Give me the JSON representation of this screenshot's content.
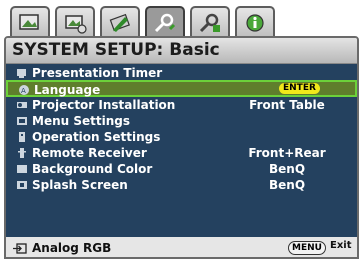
{
  "tabs": [
    {
      "icon": "picture-icon"
    },
    {
      "icon": "advanced-picture-icon"
    },
    {
      "icon": "display-icon"
    },
    {
      "icon": "system-setup-basic-icon",
      "active": true
    },
    {
      "icon": "system-setup-advanced-icon"
    },
    {
      "icon": "information-icon"
    }
  ],
  "title": "SYSTEM SETUP: Basic",
  "menu": {
    "items": [
      {
        "label": "Presentation Timer",
        "value": "",
        "icon": "timer-icon"
      },
      {
        "label": "Language",
        "value": "ENTER",
        "icon": "language-icon",
        "selected": true
      },
      {
        "label": "Projector Installation",
        "value": "Front Table",
        "icon": "projector-icon"
      },
      {
        "label": "Menu Settings",
        "value": "",
        "icon": "menu-settings-icon"
      },
      {
        "label": "Operation Settings",
        "value": "",
        "icon": "operation-settings-icon"
      },
      {
        "label": "Remote Receiver",
        "value": "Front+Rear",
        "icon": "remote-receiver-icon"
      },
      {
        "label": "Background Color",
        "value": "BenQ",
        "icon": "background-color-icon"
      },
      {
        "label": "Splash Screen",
        "value": "BenQ",
        "icon": "splash-screen-icon"
      }
    ]
  },
  "status": {
    "source": "Analog RGB",
    "menu_button": "MENU",
    "exit": "Exit"
  },
  "colors": {
    "menu_bg": "#24415f",
    "highlight_border": "#6cd13a",
    "enter_badge": "#f1e81a"
  }
}
